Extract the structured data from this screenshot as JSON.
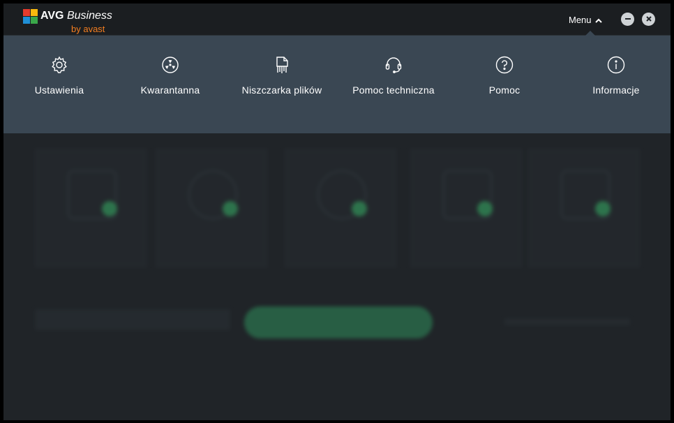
{
  "app": {
    "brand": "AVG",
    "product": "Business",
    "by": "by avast"
  },
  "titlebar": {
    "menu_label": "Menu",
    "menu_icon": "chevron-up-icon",
    "minimize_icon": "minimize-icon",
    "close_icon": "close-icon"
  },
  "menu": {
    "items": [
      {
        "label": "Ustawienia",
        "icon": "gear-icon"
      },
      {
        "label": "Kwarantanna",
        "icon": "radiation-icon"
      },
      {
        "label": "Niszczarka plików",
        "icon": "file-shredder-icon"
      },
      {
        "label": "Pomoc techniczna",
        "icon": "headset-icon"
      },
      {
        "label": "Pomoc",
        "icon": "question-icon"
      },
      {
        "label": "Informacje",
        "icon": "info-icon"
      }
    ]
  },
  "colors": {
    "accent_orange": "#f47e20",
    "menu_panel": "#3a4753",
    "status_green": "#39b56a",
    "background": "#202428"
  }
}
